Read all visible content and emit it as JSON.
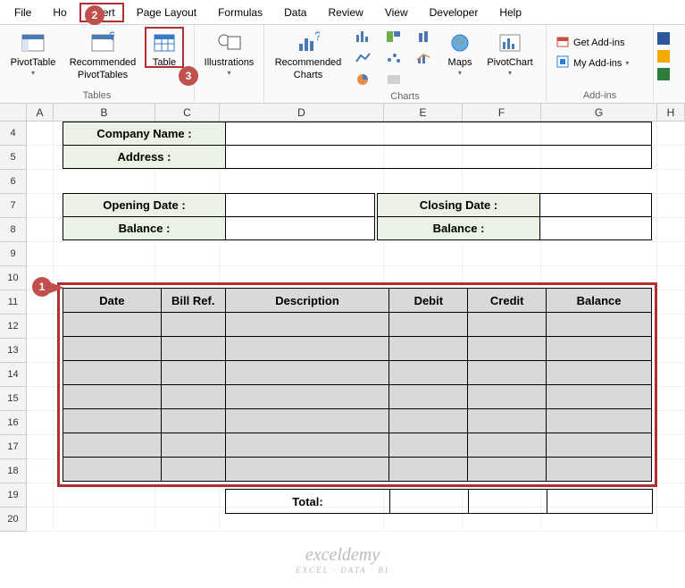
{
  "tabs": {
    "file": "File",
    "home": "Ho",
    "insert": "Insert",
    "pagelayout": "Page Layout",
    "formulas": "Formulas",
    "data": "Data",
    "review": "Review",
    "view": "View",
    "developer": "Developer",
    "help": "Help"
  },
  "ribbon": {
    "pivottable": "PivotTable",
    "recpivot_l1": "Recommended",
    "recpivot_l2": "PivotTables",
    "table": "Table",
    "illustrations": "Illustrations",
    "group_tables": "Tables",
    "recchart_l1": "Recommended",
    "recchart_l2": "Charts",
    "maps": "Maps",
    "pivotchart": "PivotChart",
    "group_charts": "Charts",
    "getaddins": "Get Add-ins",
    "myaddins": "My Add-ins",
    "group_addins": "Add-ins"
  },
  "columns": [
    "A",
    "B",
    "C",
    "D",
    "E",
    "F",
    "G",
    "H"
  ],
  "rows": [
    4,
    5,
    6,
    7,
    8,
    9,
    10,
    11,
    12,
    13,
    14,
    15,
    16,
    17,
    18,
    19,
    20
  ],
  "form": {
    "company": "Company Name :",
    "address": "Address :",
    "open_date": "Opening Date :",
    "close_date": "Closing Date :",
    "balance": "Balance :"
  },
  "ledger": {
    "date": "Date",
    "bill": "Bill Ref.",
    "desc": "Description",
    "debit": "Debit",
    "credit": "Credit",
    "balance": "Balance",
    "total": "Total:"
  },
  "callouts": {
    "c1": "1",
    "c2": "2",
    "c3": "3"
  },
  "watermark": {
    "l1": "exceldemy",
    "l2": "EXCEL · DATA · BI"
  }
}
